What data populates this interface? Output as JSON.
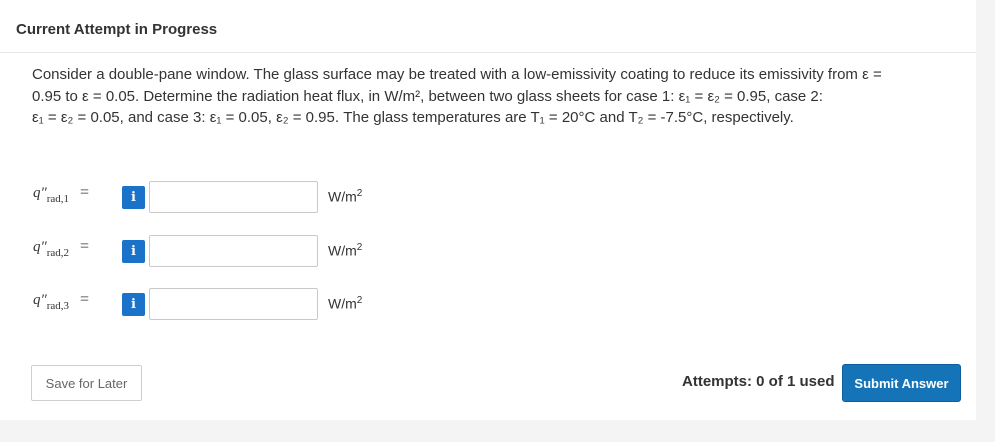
{
  "header": {
    "title": "Current Attempt in Progress"
  },
  "question": {
    "line1": "Consider a double-pane window. The glass surface may be treated with a low-emissivity coating to reduce its emissivity from ε =",
    "line2": "0.95 to ε = 0.05. Determine the radiation heat flux, in W/m², between two glass sheets for case 1: ε₁ = ε₂ = 0.95, case 2:",
    "line3": "ε₁ = ε₂ = 0.05, and case 3: ε₁ = 0.05, ε₂ = 0.95. The glass temperatures are T₁ = 20°C and T₂ = -7.5°C, respectively."
  },
  "answers": [
    {
      "var": "q″",
      "sub": "rad,1",
      "eq": "=",
      "info_icon": "i",
      "value": "",
      "unit_base": "W/m",
      "unit_exp": "2"
    },
    {
      "var": "q″",
      "sub": "rad,2",
      "eq": "=",
      "info_icon": "i",
      "value": "",
      "unit_base": "W/m",
      "unit_exp": "2"
    },
    {
      "var": "q″",
      "sub": "rad,3",
      "eq": "=",
      "info_icon": "i",
      "value": "",
      "unit_base": "W/m",
      "unit_exp": "2"
    }
  ],
  "footer": {
    "save_label": "Save for Later",
    "attempts_label": "Attempts: 0 of 1 used",
    "submit_label": "Submit Answer"
  },
  "colors": {
    "accent": "#1573b8",
    "info_icon_bg": "#1a73c8",
    "background": "#f4f4f4",
    "card": "#ffffff"
  }
}
